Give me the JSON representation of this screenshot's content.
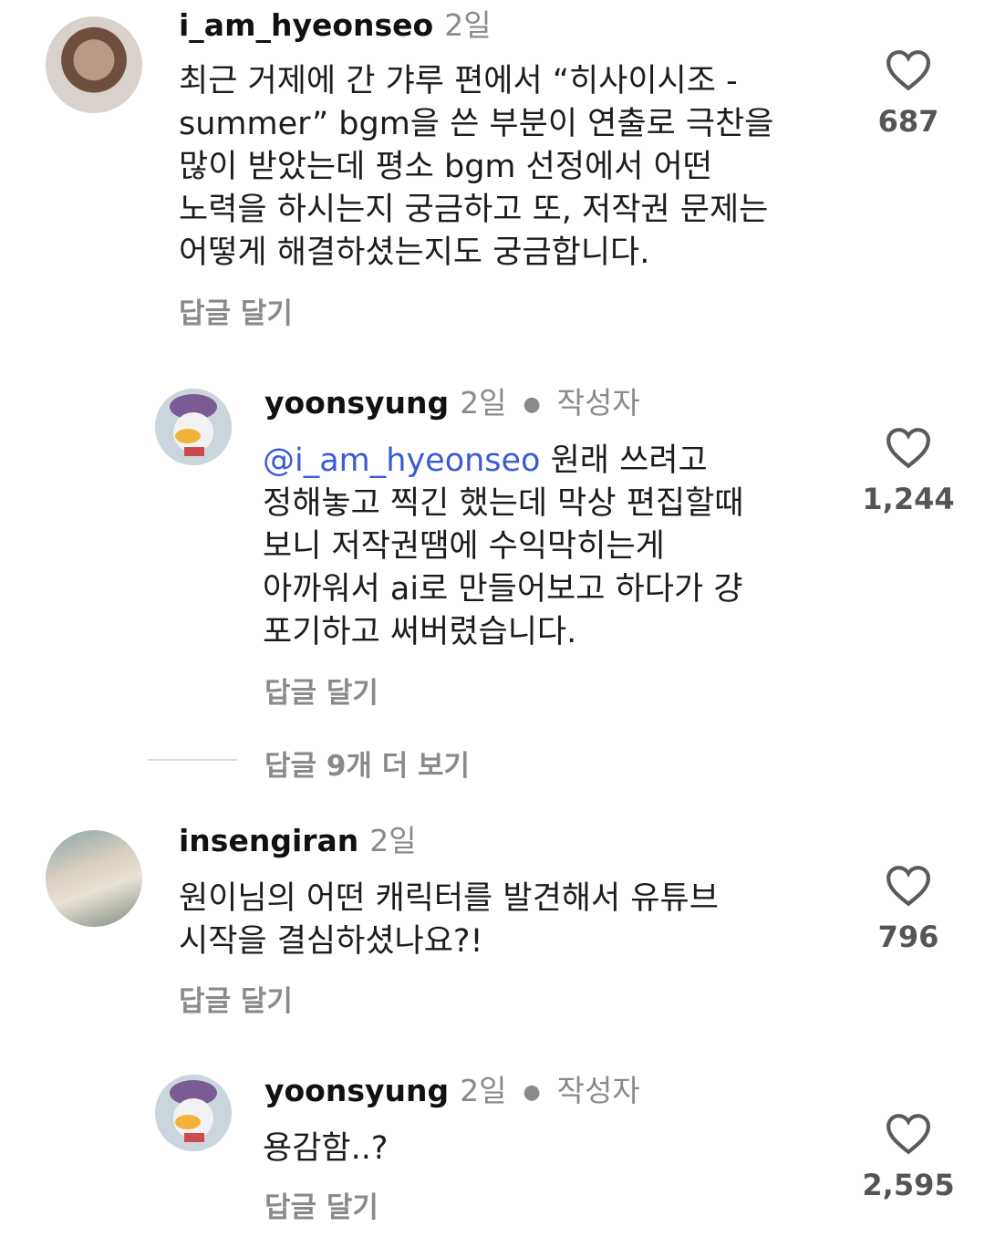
{
  "comments": [
    {
      "username": "i_am_hyeonseo",
      "time": "2일",
      "text": "최근 거제에 간 갸루 편에서 “히사이시조 -\nsummer” bgm을 쓴 부분이 연출로 극찬을\n많이 받았는데 평소 bgm 선정에서 어떤\n노력을 하시는지 궁금하고 또, 저작권 문제는\n어떻게 해결하셨는지도 궁금합니다.",
      "reply_label": "답글 달기",
      "likes": "687"
    },
    {
      "username": "yoonsyung",
      "time": "2일",
      "author_badge": "작성자",
      "mention": "@i_am_hyeonseo",
      "text": " 원래 쓰려고\n정해놓고 찍긴 했는데 막상 편집할때\n보니 저작권땜에 수익막히는게\n아까워서 ai로 만들어보고 하다가 걍\n포기하고 써버렸습니다.",
      "reply_label": "답글 달기",
      "likes": "1,244"
    },
    {
      "username": "insengiran",
      "time": "2일",
      "text": "원이님의 어떤 캐릭터를 발견해서 유튜브\n시작을 결심하셨나요?!",
      "reply_label": "답글 달기",
      "likes": "796"
    },
    {
      "username": "yoonsyung",
      "time": "2일",
      "author_badge": "작성자",
      "text": "용감함..?",
      "reply_label": "답글 달기",
      "likes": "2,595"
    }
  ],
  "view_more": "답글 9개 더 보기",
  "icons": {
    "like": "heart-outline-icon",
    "mention": "threads-icon"
  },
  "colors": {
    "mention": "#3b5bd6",
    "muted": "#8a8a8a"
  }
}
